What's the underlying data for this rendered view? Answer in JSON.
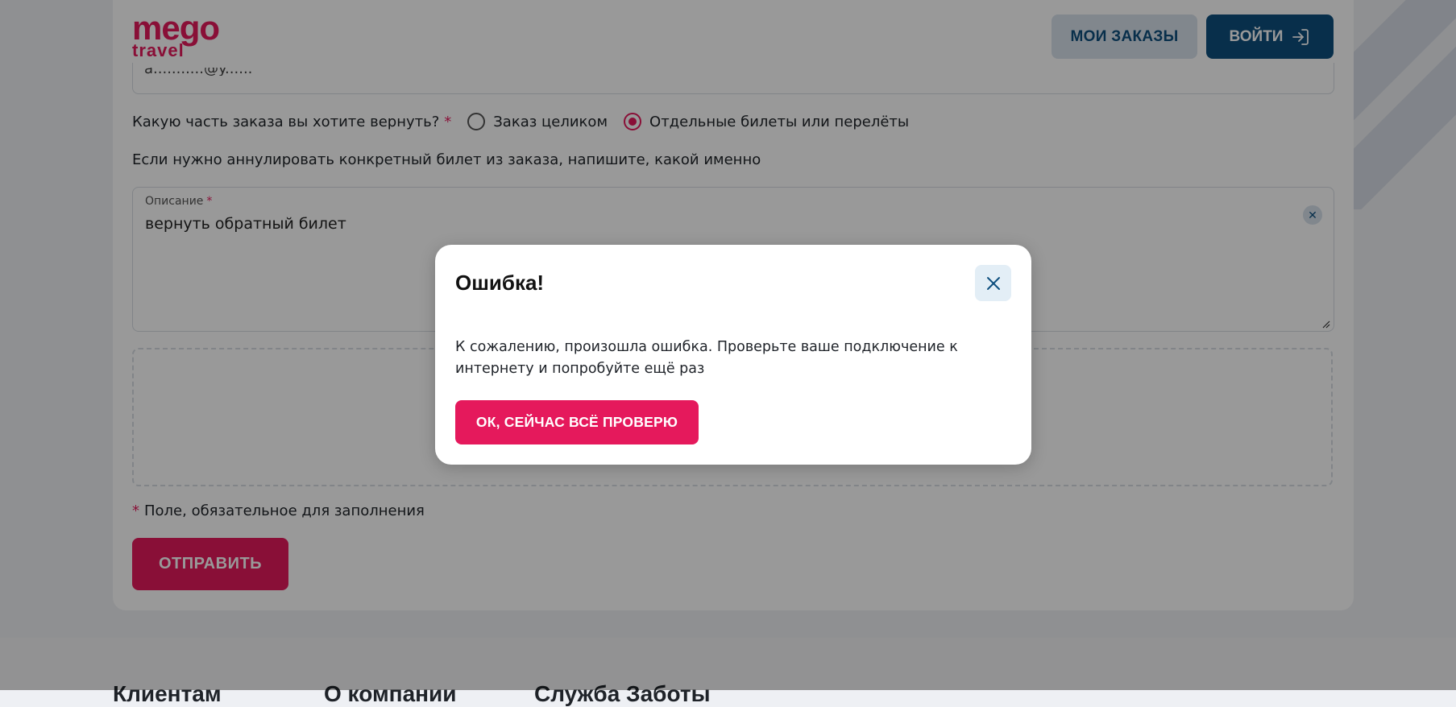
{
  "header": {
    "logo_top": "mego",
    "logo_bottom": "travel",
    "orders_label": "МОИ ЗАКАЗЫ",
    "login_label": "ВОЙТИ"
  },
  "form": {
    "email_value": "a...........@y......",
    "question": "Какую часть заказа вы хотите вернуть?",
    "required_mark": "*",
    "options": [
      {
        "label": "Заказ целиком",
        "selected": false
      },
      {
        "label": "Отдельные билеты или перелёты",
        "selected": true
      }
    ],
    "hint": "Если нужно аннулировать конкретный билет из заказа, напишите, какой именно",
    "description_label": "Описание",
    "description_value": "вернуть обратный билет",
    "required_note": "Поле, обязательное для заполнения",
    "submit_label": "ОТПРАВИТЬ"
  },
  "footer": {
    "headings": [
      "Клиентам",
      "О компании",
      "Служба Заботы"
    ]
  },
  "modal": {
    "title": "Ошибка!",
    "message": "К сожалению, произошла ошибка. Проверьте ваше подключение к интернету и попробуйте ещё раз",
    "ok_label": "ОК, СЕЙЧАС ВСЁ ПРОВЕРЮ"
  },
  "colors": {
    "brand": "#e5195c",
    "primary": "#0e4f7e",
    "secondary_button": "#d7e2ec"
  }
}
